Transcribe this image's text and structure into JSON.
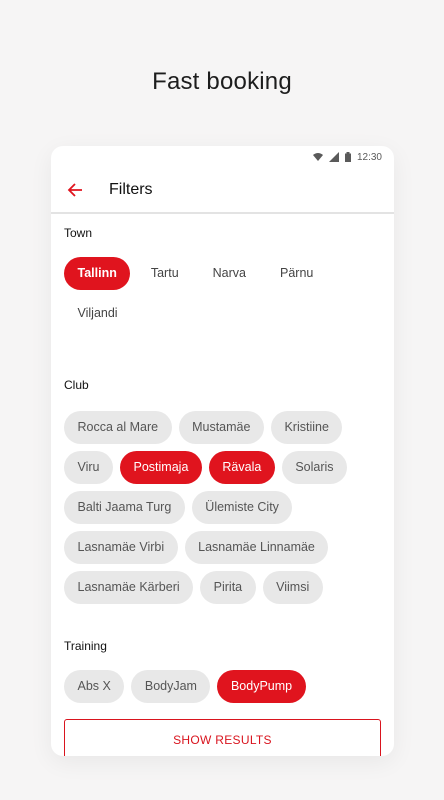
{
  "headline": "Fast booking",
  "status": {
    "time": "12:30"
  },
  "toolbar": {
    "title": "Filters"
  },
  "sections": {
    "town": {
      "label": "Town",
      "chips": [
        {
          "label": "Tallinn",
          "selected": true
        },
        {
          "label": "Tartu",
          "selected": false
        },
        {
          "label": "Narva",
          "selected": false
        },
        {
          "label": "Pärnu",
          "selected": false
        },
        {
          "label": "Viljandi",
          "selected": false
        }
      ]
    },
    "club": {
      "label": "Club",
      "chips": [
        {
          "label": "Rocca al Mare",
          "selected": false
        },
        {
          "label": "Mustamäe",
          "selected": false
        },
        {
          "label": "Kristiine",
          "selected": false
        },
        {
          "label": "Viru",
          "selected": false
        },
        {
          "label": "Postimaja",
          "selected": true
        },
        {
          "label": "Rävala",
          "selected": true
        },
        {
          "label": "Solaris",
          "selected": false
        },
        {
          "label": "Balti Jaama Turg",
          "selected": false
        },
        {
          "label": "Ülemiste City",
          "selected": false
        },
        {
          "label": "Lasnamäe Virbi",
          "selected": false
        },
        {
          "label": "Lasnamäe Linnamäe",
          "selected": false
        },
        {
          "label": "Lasnamäe Kärberi",
          "selected": false
        },
        {
          "label": "Pirita",
          "selected": false
        },
        {
          "label": "Viimsi",
          "selected": false
        }
      ]
    },
    "training": {
      "label": "Training",
      "chips": [
        {
          "label": "Abs X",
          "selected": false
        },
        {
          "label": "BodyJam",
          "selected": false
        },
        {
          "label": "BodyPump",
          "selected": true
        }
      ]
    }
  },
  "show_results_label": "SHOW RESULTS",
  "colors": {
    "accent": "#e0141e",
    "chip_bg": "#e8e8e8",
    "page_bg": "#f6f5f5"
  },
  "icons": {
    "back": "arrow-left-icon",
    "wifi": "wifi-icon",
    "signal": "signal-icon",
    "battery": "battery-icon"
  }
}
